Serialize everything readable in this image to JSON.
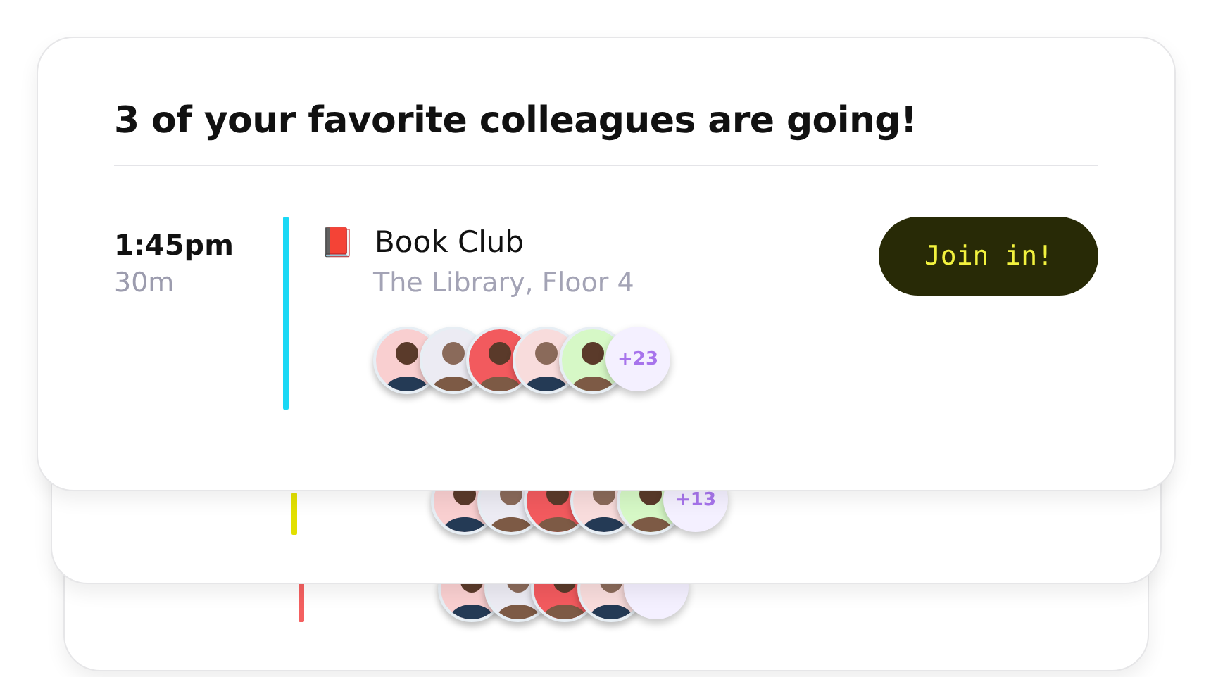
{
  "card": {
    "title": "3 of your favorite colleagues are going!",
    "event": {
      "time": "1:45pm",
      "duration": "30m",
      "icon": "📕",
      "name": "Book Club",
      "location": "The Library, Floor 4",
      "color": "#1ad8f5",
      "button": "Join in!",
      "attendees": [
        {
          "color": "#f9cfd0"
        },
        {
          "color": "#ecebf3"
        },
        {
          "color": "#f25a5e"
        },
        {
          "color": "#f8dcdc"
        },
        {
          "color": "#d6f8c6"
        }
      ],
      "more": "+23"
    }
  },
  "back_cards": [
    {
      "color": "#e2e000",
      "attendees": [
        {
          "color": "#f9cfd0"
        },
        {
          "color": "#ecebf3"
        },
        {
          "color": "#f25a5e"
        },
        {
          "color": "#f8dcdc"
        },
        {
          "color": "#d6f8c6"
        }
      ],
      "more": "+13"
    },
    {
      "color": "#f46060",
      "attendees": [
        {
          "color": "#f9cfd0"
        },
        {
          "color": "#ecebf3"
        },
        {
          "color": "#f25a5e"
        },
        {
          "color": "#f8dcdc"
        }
      ]
    }
  ]
}
